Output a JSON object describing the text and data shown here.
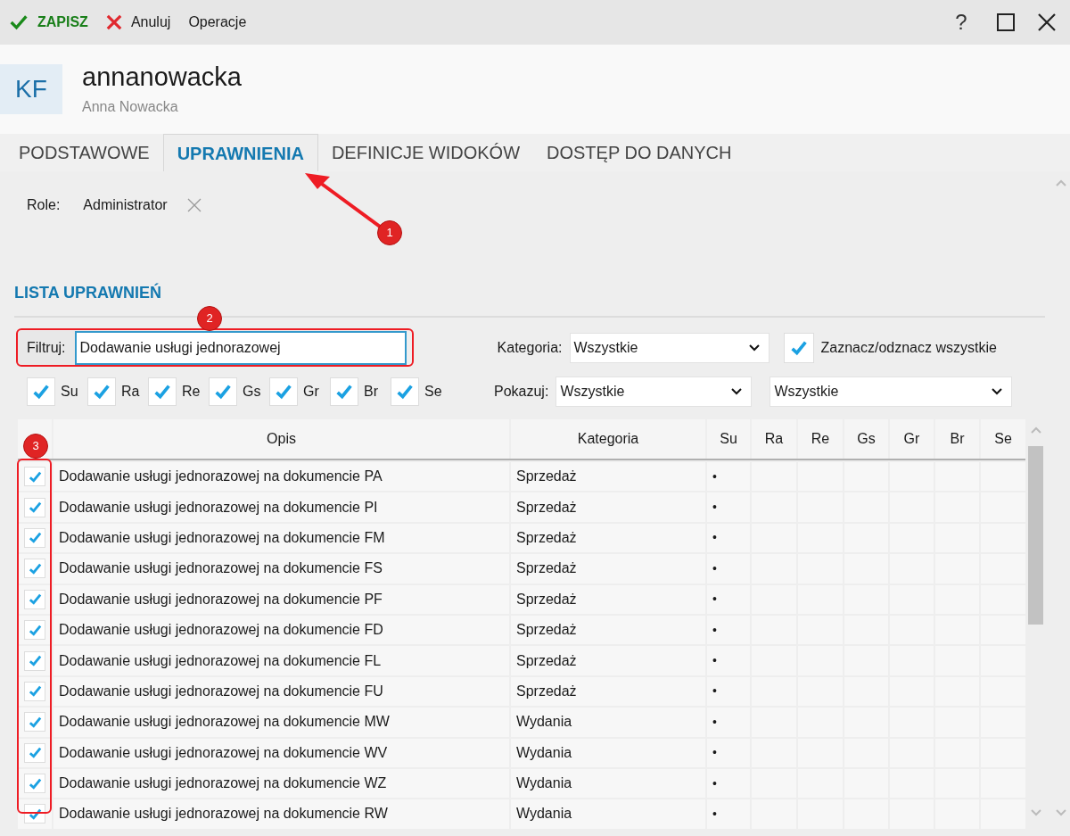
{
  "toolbar": {
    "save": "ZAPISZ",
    "cancel": "Anuluj",
    "operations": "Operacje",
    "help": "?"
  },
  "header": {
    "initials": "KF",
    "login": "annanowacka",
    "full_name": "Anna Nowacka"
  },
  "tabs": [
    {
      "label": "PODSTAWOWE",
      "selected": false
    },
    {
      "label": "UPRAWNIENIA",
      "selected": true
    },
    {
      "label": "DEFINICJE WIDOKÓW",
      "selected": false
    },
    {
      "label": "DOSTĘP DO DANYCH",
      "selected": false
    }
  ],
  "role": {
    "label": "Role:",
    "value": "Administrator"
  },
  "section_title": "LISTA UPRAWNIEŃ",
  "filter": {
    "label": "Filtruj:",
    "value": "Dodawanie usługi jednorazowej"
  },
  "category": {
    "label": "Kategoria:",
    "value": "Wszystkie"
  },
  "select_all": {
    "label": "Zaznacz/odznacz wszystkie",
    "checked": true
  },
  "flags": [
    {
      "label": "Su",
      "checked": true
    },
    {
      "label": "Ra",
      "checked": true
    },
    {
      "label": "Re",
      "checked": true
    },
    {
      "label": "Gs",
      "checked": true
    },
    {
      "label": "Gr",
      "checked": true
    },
    {
      "label": "Br",
      "checked": true
    },
    {
      "label": "Se",
      "checked": true
    }
  ],
  "show": {
    "label": "Pokazuj:",
    "value": "Wszystkie",
    "value_2": "Wszystkie"
  },
  "table": {
    "columns": [
      "Opis",
      "Kategoria",
      "Su",
      "Ra",
      "Re",
      "Gs",
      "Gr",
      "Br",
      "Se"
    ],
    "rows": [
      {
        "checked": true,
        "opis": "Dodawanie usługi jednorazowej na dokumencie PA",
        "kategoria": "Sprzedaż",
        "su": "•"
      },
      {
        "checked": true,
        "opis": "Dodawanie usługi jednorazowej na dokumencie PI",
        "kategoria": "Sprzedaż",
        "su": "•"
      },
      {
        "checked": true,
        "opis": "Dodawanie usługi jednorazowej na dokumencie FM",
        "kategoria": "Sprzedaż",
        "su": "•"
      },
      {
        "checked": true,
        "opis": "Dodawanie usługi jednorazowej na dokumencie FS",
        "kategoria": "Sprzedaż",
        "su": "•"
      },
      {
        "checked": true,
        "opis": "Dodawanie usługi jednorazowej na dokumencie PF",
        "kategoria": "Sprzedaż",
        "su": "•"
      },
      {
        "checked": true,
        "opis": "Dodawanie usługi jednorazowej na dokumencie FD",
        "kategoria": "Sprzedaż",
        "su": "•"
      },
      {
        "checked": true,
        "opis": "Dodawanie usługi jednorazowej na dokumencie FL",
        "kategoria": "Sprzedaż",
        "su": "•"
      },
      {
        "checked": true,
        "opis": "Dodawanie usługi jednorazowej na dokumencie FU",
        "kategoria": "Sprzedaż",
        "su": "•"
      },
      {
        "checked": true,
        "opis": "Dodawanie usługi jednorazowej na dokumencie MW",
        "kategoria": "Wydania",
        "su": "•"
      },
      {
        "checked": true,
        "opis": "Dodawanie usługi jednorazowej na dokumencie WV",
        "kategoria": "Wydania",
        "su": "•"
      },
      {
        "checked": true,
        "opis": "Dodawanie usługi jednorazowej na dokumencie WZ",
        "kategoria": "Wydania",
        "su": "•"
      },
      {
        "checked": true,
        "opis": "Dodawanie usługi jednorazowej na dokumencie RW",
        "kategoria": "Wydania",
        "su": "•"
      }
    ]
  },
  "annotations": [
    "1",
    "2",
    "3"
  ]
}
